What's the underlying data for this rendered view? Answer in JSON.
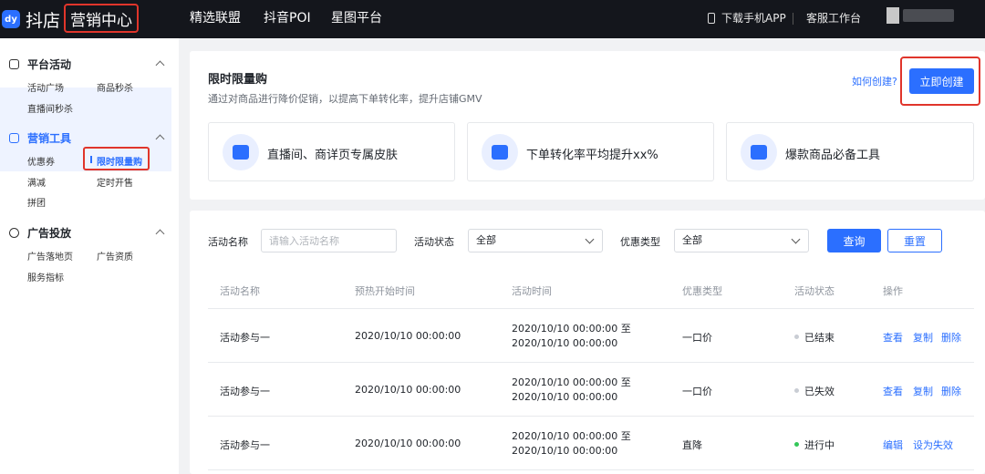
{
  "topbar": {
    "logo_mark": "dy",
    "logo_text": "抖店",
    "center_title": "营销中心",
    "nav": [
      "精选联盟",
      "抖音POI",
      "星图平台"
    ],
    "download_app": "下载手机APP",
    "service_desk": "客服工作台"
  },
  "sidebar": {
    "groups": [
      {
        "title": "平台活动",
        "items": [
          "活动广场",
          "商品秒杀",
          "直播间秒杀"
        ]
      },
      {
        "title": "营销工具",
        "items": [
          "优惠券",
          "限时限量购",
          "满减",
          "定时开售",
          "拼团"
        ]
      },
      {
        "title": "广告投放",
        "items": [
          "广告落地页",
          "广告资质",
          "服务指标"
        ]
      }
    ]
  },
  "intro": {
    "title": "限时限量购",
    "description": "通过对商品进行降价促销，以提高下单转化率，提升店铺GMV",
    "how_to_link": "如何创建?",
    "create_button": "立即创建",
    "features": [
      "直播间、商详页专属皮肤",
      "下单转化率平均提升xx%",
      "爆款商品必备工具"
    ]
  },
  "filters": {
    "name_label": "活动名称",
    "name_placeholder": "请输入活动名称",
    "status_label": "活动状态",
    "status_value": "全部",
    "discount_label": "优惠类型",
    "discount_value": "全部",
    "query_button": "查询",
    "reset_button": "重置"
  },
  "table": {
    "headers": [
      "活动名称",
      "预热开始时间",
      "活动时间",
      "优惠类型",
      "活动状态",
      "操作"
    ],
    "rows": [
      {
        "name": "活动参与一",
        "preheat": "2020/10/10 00:00:00",
        "time_start": "2020/10/10 00:00:00 至",
        "time_end": "2020/10/10 00:00:00",
        "type": "一口价",
        "status": "已结束",
        "status_color": "#c9cdd4",
        "ops": [
          "查看",
          "复制",
          "删除"
        ]
      },
      {
        "name": "活动参与一",
        "preheat": "2020/10/10 00:00:00",
        "time_start": "2020/10/10 00:00:00 至",
        "time_end": "2020/10/10 00:00:00",
        "type": "一口价",
        "status": "已失效",
        "status_color": "#c9cdd4",
        "ops": [
          "查看",
          "复制",
          "删除"
        ]
      },
      {
        "name": "活动参与一",
        "preheat": "2020/10/10 00:00:00",
        "time_start": "2020/10/10 00:00:00 至",
        "time_end": "2020/10/10 00:00:00",
        "type": "直降",
        "status": "进行中",
        "status_color": "#34c759",
        "ops": [
          "编辑",
          "设为失效"
        ]
      }
    ]
  }
}
